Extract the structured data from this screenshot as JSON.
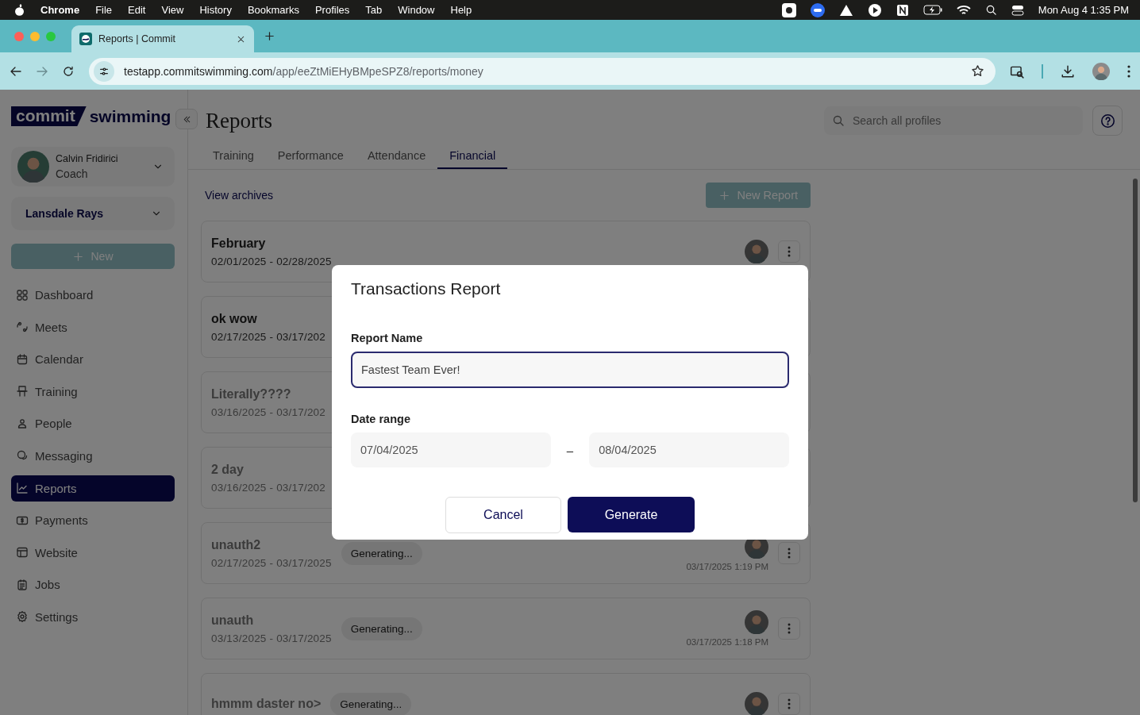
{
  "menubar": {
    "app": "Chrome",
    "items": [
      "File",
      "Edit",
      "View",
      "History",
      "Bookmarks",
      "Profiles",
      "Tab",
      "Window",
      "Help"
    ],
    "clock": "Mon Aug 4  1:35 PM"
  },
  "browser": {
    "tab_title": "Reports | Commit",
    "url_host": "testapp.commitswimming.com",
    "url_path": "/app/eeZtMiEHyBMpeSPZ8/reports/money"
  },
  "sidebar": {
    "logo_left": "commit",
    "logo_right": "swimming",
    "user": {
      "name": "Calvin Fridirici",
      "role": "Coach"
    },
    "team": "Lansdale Rays",
    "new_button": "New",
    "items": [
      {
        "label": "Dashboard",
        "selected": false
      },
      {
        "label": "Meets",
        "selected": false
      },
      {
        "label": "Calendar",
        "selected": false
      },
      {
        "label": "Training",
        "selected": false
      },
      {
        "label": "People",
        "selected": false
      },
      {
        "label": "Messaging",
        "selected": false
      },
      {
        "label": "Reports",
        "selected": true
      },
      {
        "label": "Payments",
        "selected": false
      },
      {
        "label": "Website",
        "selected": false
      },
      {
        "label": "Jobs",
        "selected": false
      },
      {
        "label": "Settings",
        "selected": false
      }
    ]
  },
  "header": {
    "title": "Reports",
    "search_placeholder": "Search all profiles"
  },
  "tabs": [
    {
      "label": "Training",
      "selected": false
    },
    {
      "label": "Performance",
      "selected": false
    },
    {
      "label": "Attendance",
      "selected": false
    },
    {
      "label": "Financial",
      "selected": true
    }
  ],
  "view_archives": "View archives",
  "new_report": "New Report",
  "reports": [
    {
      "title": "February",
      "dates": "02/01/2025 - 02/28/2025",
      "pending": false,
      "owner_shown": true
    },
    {
      "title": "ok wow",
      "dates": "02/17/2025 - 03/17/202",
      "pending": false,
      "owner_shown": false
    },
    {
      "title": "Literally????",
      "dates": "03/16/2025 - 03/17/202",
      "pending": true,
      "owner_shown": false
    },
    {
      "title": "2 day",
      "dates": "03/16/2025 - 03/17/202",
      "pending": true,
      "owner_shown": false
    },
    {
      "title": "unauth2",
      "dates": "02/17/2025 - 03/17/2025",
      "pending": true,
      "status": "Generating...",
      "timestamp": "03/17/2025 1:19 PM",
      "owner_shown": true
    },
    {
      "title": "unauth",
      "dates": "03/13/2025 - 03/17/2025",
      "pending": true,
      "status": "Generating...",
      "timestamp": "03/17/2025 1:18 PM",
      "owner_shown": true
    },
    {
      "title": "hmmm daster no>",
      "pending": true,
      "status": "Generating...",
      "owner_shown": true
    }
  ],
  "modal": {
    "title": "Transactions Report",
    "name_label": "Report Name",
    "name_value": "Fastest Team Ever!",
    "range_label": "Date range",
    "start": "07/04/2025",
    "separator": "–",
    "end": "08/04/2025",
    "cancel": "Cancel",
    "generate": "Generate"
  }
}
